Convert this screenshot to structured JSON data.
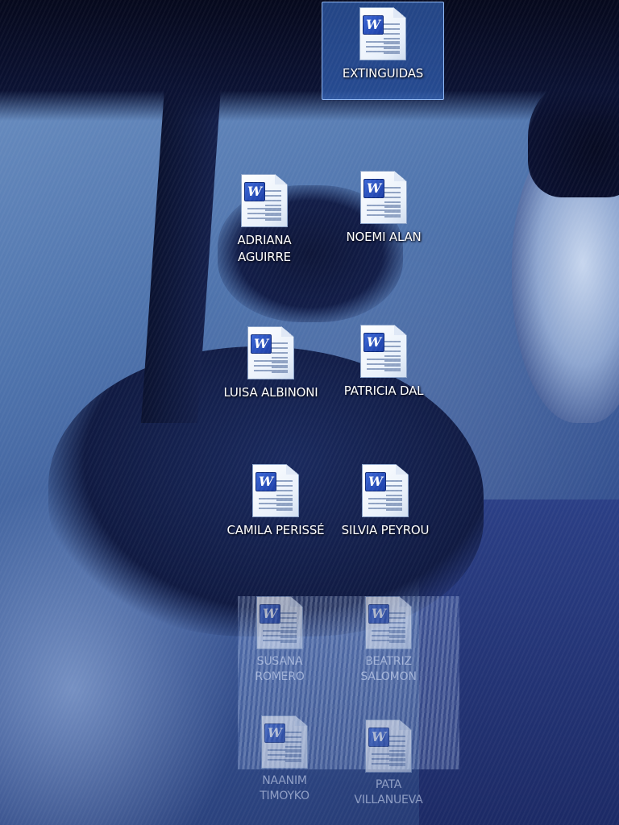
{
  "desktop": {
    "icons": [
      {
        "label": "EXTINGUIDAS",
        "icon": "word-document-icon",
        "selected": true
      },
      {
        "label": "ADRIANA AGUIRRE",
        "icon": "word-document-icon"
      },
      {
        "label": "NOEMI ALAN",
        "icon": "word-document-icon"
      },
      {
        "label": "LUISA ALBINONI",
        "icon": "word-document-icon"
      },
      {
        "label": "PATRICIA DAL",
        "icon": "word-document-icon"
      },
      {
        "label": "CAMILA PERISSÉ",
        "icon": "word-document-icon"
      },
      {
        "label": "SILVIA PEYROU",
        "icon": "word-document-icon"
      },
      {
        "label": "SUSANA ROMERO",
        "icon": "word-document-icon",
        "faded": true
      },
      {
        "label": "BEATRIZ SALOMON",
        "icon": "word-document-icon",
        "faded": true
      },
      {
        "label": "NAANIM TIMOYKO",
        "icon": "word-document-icon",
        "faded": true
      },
      {
        "label": "PATA VILLANUEVA",
        "icon": "word-document-icon",
        "faded": true
      }
    ],
    "word_badge": "W",
    "colors": {
      "selection": "#3c78dc",
      "badge": "#1c3ea6"
    }
  }
}
